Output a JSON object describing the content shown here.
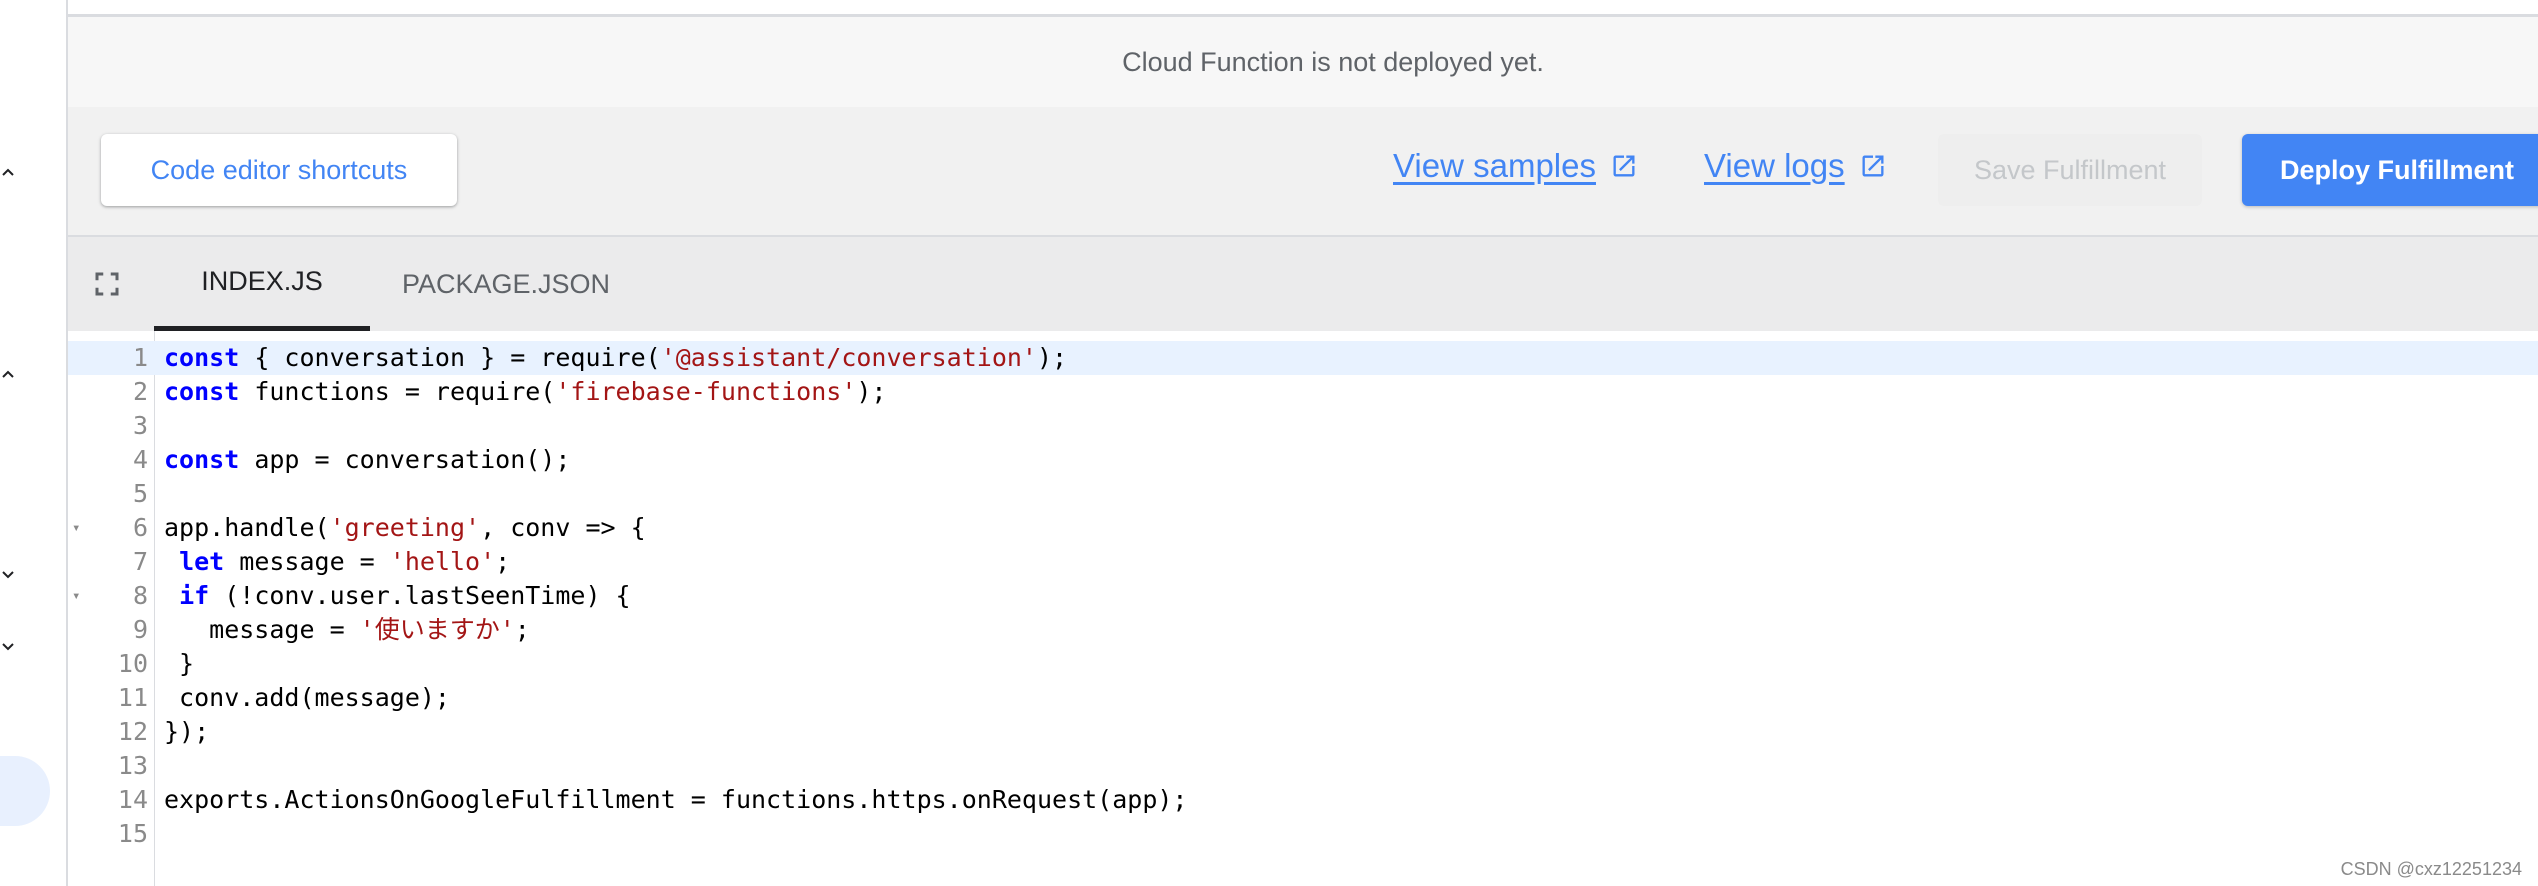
{
  "status": {
    "text": "Cloud Function is not deployed yet."
  },
  "toolbar": {
    "shortcuts_label": "Code editor shortcuts",
    "view_samples_label": "View samples",
    "view_logs_label": "View logs",
    "save_label": "Save Fulfillment",
    "deploy_label": "Deploy Fulfillment"
  },
  "tabs": [
    {
      "label": "INDEX.JS",
      "active": true
    },
    {
      "label": "PACKAGE.JSON",
      "active": false
    }
  ],
  "icons": {
    "fullscreen": "fullscreen-icon",
    "external_link": "open-in-new-icon",
    "rail": [
      "chevron-up-icon",
      "chevron-up-icon",
      "chevron-down-icon",
      "chevron-down-icon"
    ]
  },
  "editor": {
    "active_line": 1,
    "lines": [
      {
        "num": "1",
        "parts": [
          {
            "t": "const",
            "c": "kw"
          },
          {
            "t": " { conversation } = require("
          },
          {
            "t": "'@assistant/conversation'",
            "c": "str"
          },
          {
            "t": ");"
          }
        ]
      },
      {
        "num": "2",
        "parts": [
          {
            "t": "const",
            "c": "kw"
          },
          {
            "t": " functions = require("
          },
          {
            "t": "'firebase-functions'",
            "c": "str"
          },
          {
            "t": ");"
          }
        ]
      },
      {
        "num": "3",
        "parts": []
      },
      {
        "num": "4",
        "parts": [
          {
            "t": "const",
            "c": "kw"
          },
          {
            "t": " app = conversation();"
          }
        ]
      },
      {
        "num": "5",
        "parts": []
      },
      {
        "num": "6",
        "fold": true,
        "parts": [
          {
            "t": "app.handle("
          },
          {
            "t": "'greeting'",
            "c": "str"
          },
          {
            "t": ", conv => {"
          }
        ]
      },
      {
        "num": "7",
        "parts": [
          {
            "t": " "
          },
          {
            "t": "let",
            "c": "kw"
          },
          {
            "t": " message = "
          },
          {
            "t": "'hello'",
            "c": "str"
          },
          {
            "t": ";"
          }
        ]
      },
      {
        "num": "8",
        "fold": true,
        "parts": [
          {
            "t": " "
          },
          {
            "t": "if",
            "c": "kw"
          },
          {
            "t": " (!conv.user.lastSeenTime) {"
          }
        ]
      },
      {
        "num": "9",
        "parts": [
          {
            "t": "   message = "
          },
          {
            "t": "'使いますか'",
            "c": "str"
          },
          {
            "t": ";"
          }
        ]
      },
      {
        "num": "10",
        "parts": [
          {
            "t": " }"
          }
        ]
      },
      {
        "num": "11",
        "parts": [
          {
            "t": " conv.add(message);"
          }
        ]
      },
      {
        "num": "12",
        "parts": [
          {
            "t": "});"
          }
        ]
      },
      {
        "num": "13",
        "parts": []
      },
      {
        "num": "14",
        "parts": [
          {
            "t": "exports.ActionsOnGoogleFulfillment = functions.https.onRequest(app);"
          }
        ]
      },
      {
        "num": "15",
        "parts": []
      }
    ]
  },
  "watermark": "CSDN @cxz12251234",
  "colors": {
    "accent": "#4285f4",
    "string": "#a31515",
    "keyword": "#0000ff"
  }
}
